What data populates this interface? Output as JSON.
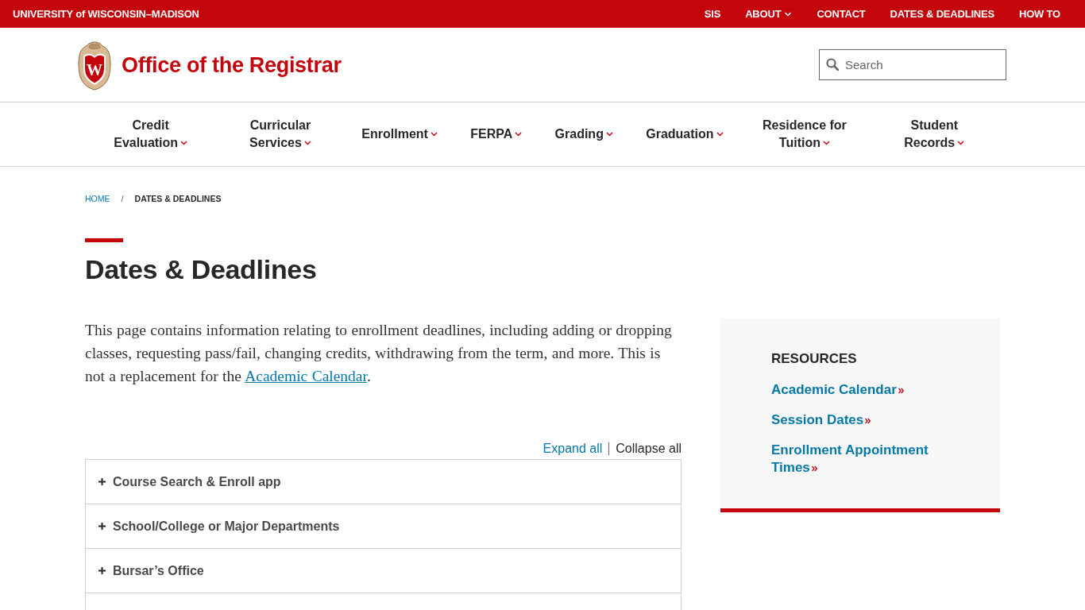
{
  "top_bar": {
    "brand": "UNIVERSITY of WISCONSIN–MADISON",
    "links": [
      {
        "label": "SIS",
        "has_menu": false
      },
      {
        "label": "ABOUT",
        "has_menu": true
      },
      {
        "label": "CONTACT",
        "has_menu": false
      },
      {
        "label": "DATES & DEADLINES",
        "has_menu": false
      },
      {
        "label": "HOW TO",
        "has_menu": false
      }
    ]
  },
  "header": {
    "logo_letter": "W",
    "title": "Office of the Registrar",
    "search": {
      "placeholder": "Search"
    }
  },
  "main_nav": [
    {
      "label": "Credit Evaluation",
      "has_menu": true
    },
    {
      "label": "Curricular Services",
      "has_menu": true
    },
    {
      "label": "Enrollment",
      "has_menu": true
    },
    {
      "label": "FERPA",
      "has_menu": true
    },
    {
      "label": "Grading",
      "has_menu": true
    },
    {
      "label": "Graduation",
      "has_menu": true
    },
    {
      "label": "Residence for Tuition",
      "has_menu": true
    },
    {
      "label": "Student Records",
      "has_menu": true
    }
  ],
  "breadcrumb": {
    "separator": "/",
    "items": [
      {
        "label": "HOME",
        "current": false
      },
      {
        "label": "DATES & DEADLINES",
        "current": true
      }
    ]
  },
  "page": {
    "title": "Dates & Deadlines",
    "intro": {
      "text": "This page contains information relating to enrollment deadlines, including adding or dropping classes, requesting pass/fail, changing credits, withdrawing from the term, and more. This is not a replacement for the",
      "link": "Academic Calendar",
      "after": "."
    }
  },
  "accordion": {
    "controls": [
      {
        "label": "Expand all",
        "disabled": false
      },
      {
        "label": "Collapse all",
        "disabled": true
      }
    ],
    "items": [
      {
        "title": "Course Search & Enroll app",
        "expanded": false
      },
      {
        "title": "School/College or Major Departments",
        "expanded": false
      },
      {
        "title": "Bursar’s Office",
        "expanded": false
      }
    ]
  },
  "sidebar": {
    "heading": "RESOURCES",
    "links": [
      "Academic Calendar",
      "Session Dates",
      "Enrollment Appointment Times"
    ]
  }
}
